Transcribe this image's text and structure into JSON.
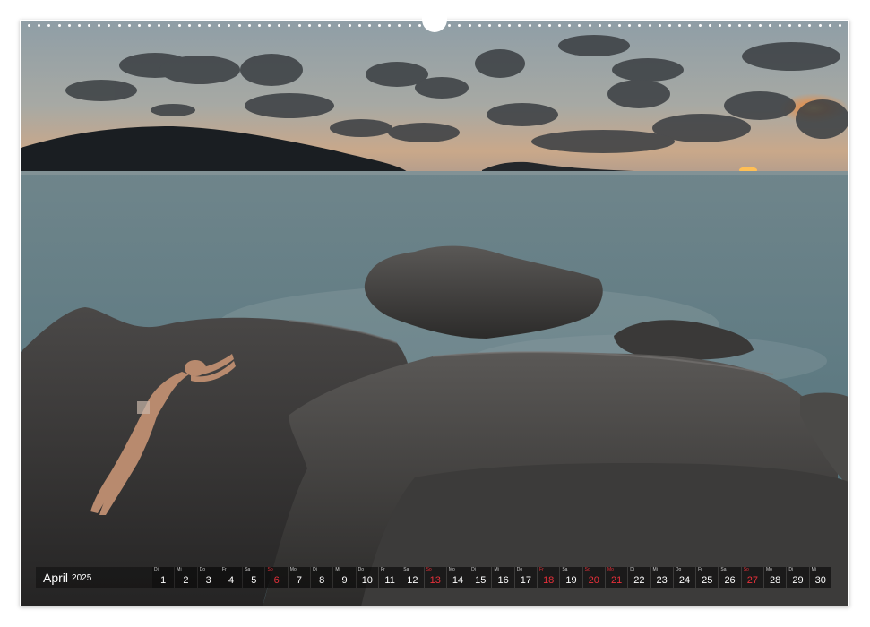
{
  "calendar": {
    "month": "April",
    "year": "2025",
    "days": [
      {
        "wd": "Di",
        "n": "1",
        "red": false
      },
      {
        "wd": "Mi",
        "n": "2",
        "red": false
      },
      {
        "wd": "Do",
        "n": "3",
        "red": false
      },
      {
        "wd": "Fr",
        "n": "4",
        "red": false
      },
      {
        "wd": "Sa",
        "n": "5",
        "red": false
      },
      {
        "wd": "So",
        "n": "6",
        "red": true
      },
      {
        "wd": "Mo",
        "n": "7",
        "red": false
      },
      {
        "wd": "Di",
        "n": "8",
        "red": false
      },
      {
        "wd": "Mi",
        "n": "9",
        "red": false
      },
      {
        "wd": "Do",
        "n": "10",
        "red": false
      },
      {
        "wd": "Fr",
        "n": "11",
        "red": false
      },
      {
        "wd": "Sa",
        "n": "12",
        "red": false
      },
      {
        "wd": "So",
        "n": "13",
        "red": true
      },
      {
        "wd": "Mo",
        "n": "14",
        "red": false
      },
      {
        "wd": "Di",
        "n": "15",
        "red": false
      },
      {
        "wd": "Mi",
        "n": "16",
        "red": false
      },
      {
        "wd": "Do",
        "n": "17",
        "red": false
      },
      {
        "wd": "Fr",
        "n": "18",
        "red": true
      },
      {
        "wd": "Sa",
        "n": "19",
        "red": false
      },
      {
        "wd": "So",
        "n": "20",
        "red": true
      },
      {
        "wd": "Mo",
        "n": "21",
        "red": true
      },
      {
        "wd": "Di",
        "n": "22",
        "red": false
      },
      {
        "wd": "Mi",
        "n": "23",
        "red": false
      },
      {
        "wd": "Do",
        "n": "24",
        "red": false
      },
      {
        "wd": "Fr",
        "n": "25",
        "red": false
      },
      {
        "wd": "Sa",
        "n": "26",
        "red": false
      },
      {
        "wd": "So",
        "n": "27",
        "red": true
      },
      {
        "wd": "Mo",
        "n": "28",
        "red": false
      },
      {
        "wd": "Di",
        "n": "29",
        "red": false
      },
      {
        "wd": "Mi",
        "n": "30",
        "red": false
      }
    ]
  },
  "colors": {
    "holiday_red": "#e8303a",
    "sunset_orange": "#f08a3a",
    "sea": "#5e7a82"
  }
}
